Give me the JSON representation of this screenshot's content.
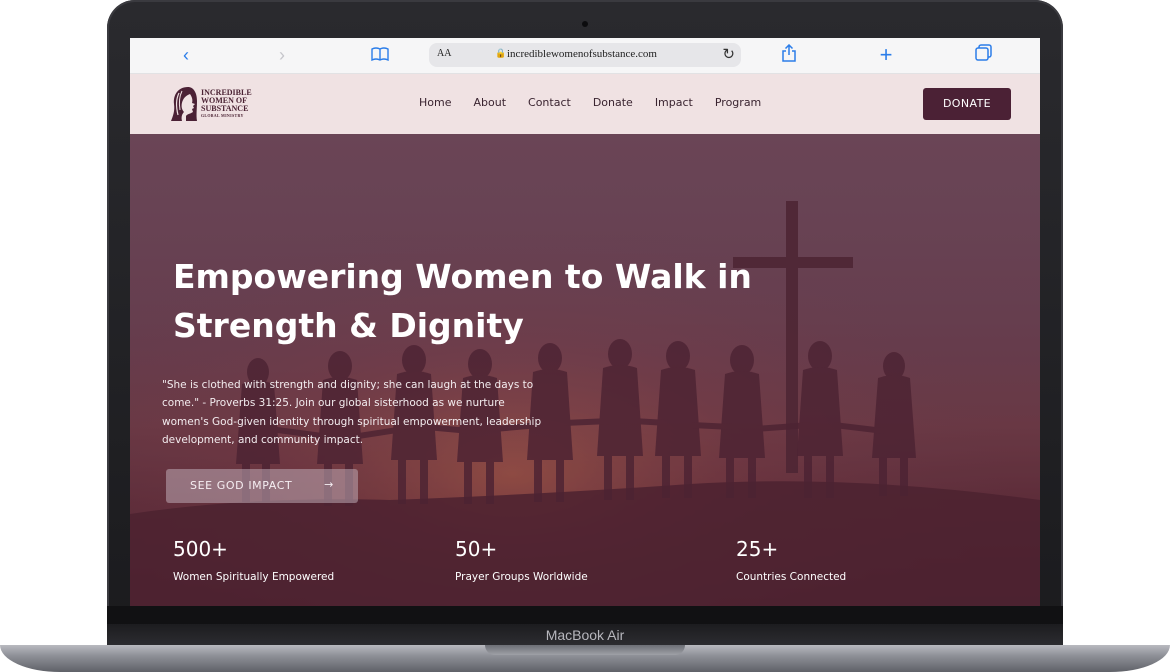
{
  "browser": {
    "text_size_label": "AA",
    "url": "incrediblewomenofsubstance.com"
  },
  "site": {
    "logo_lines": [
      "INCREDIBLE",
      "WOMEN OF",
      "SUBSTANCE"
    ],
    "logo_tagline": "GLOBAL MINISTRY",
    "nav": [
      "Home",
      "About",
      "Contact",
      "Donate",
      "Impact",
      "Program"
    ],
    "donate_button": "DONATE"
  },
  "hero": {
    "title_line1": "Empowering Women to Walk in",
    "title_line2": "Strength & Dignity",
    "quote": "\"She is clothed with strength and dignity; she can laugh at the days to come.\" - Proverbs 31:25. Join our global sisterhood as we nurture women's God-given identity through spiritual empowerment, leadership development, and community impact.",
    "cta_label": "SEE GOD IMPACT",
    "cta_arrow": "→",
    "stats": [
      {
        "value": "500+",
        "caption": "Women Spiritually Empowered"
      },
      {
        "value": "50+",
        "caption": "Prayer Groups Worldwide"
      },
      {
        "value": "25+",
        "caption": "Countries Connected"
      }
    ]
  },
  "device": {
    "label": "MacBook Air"
  },
  "colors": {
    "brand": "#4b2135",
    "nav_bg": "#f0e2e3",
    "link_blue": "#2b7de9"
  }
}
